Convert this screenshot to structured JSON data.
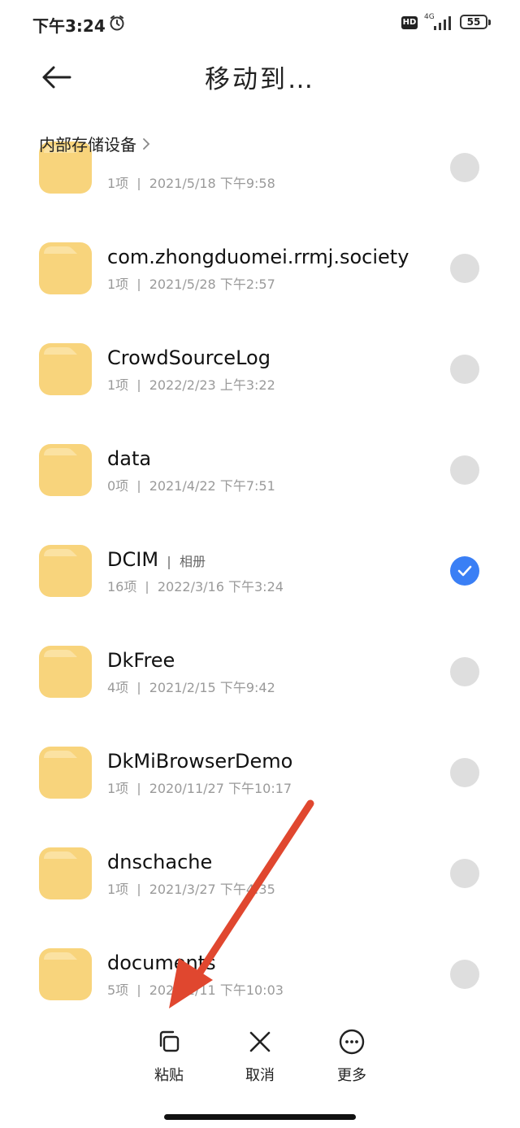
{
  "status_bar": {
    "time": "下午3:24",
    "hd_badge": "HD",
    "network": "4G",
    "battery": "55",
    "icons": [
      "alarm-icon",
      "signal-icon",
      "battery-icon"
    ]
  },
  "header": {
    "title": "移动到…",
    "back_icon": "back-arrow-icon"
  },
  "breadcrumb": {
    "label": "内部存储设备"
  },
  "folders": [
    {
      "name": "",
      "tag": "",
      "count": "1项",
      "date": "2021/5/18 下午9:58",
      "selected": false
    },
    {
      "name": "com.zhongduomei.rrmj.society",
      "tag": "",
      "count": "1项",
      "date": "2021/5/28 下午2:57",
      "selected": false
    },
    {
      "name": "CrowdSourceLog",
      "tag": "",
      "count": "1项",
      "date": "2022/2/23 上午3:22",
      "selected": false
    },
    {
      "name": "data",
      "tag": "",
      "count": "0项",
      "date": "2021/4/22 下午7:51",
      "selected": false
    },
    {
      "name": "DCIM",
      "tag": "相册",
      "count": "16项",
      "date": "2022/3/16 下午3:24",
      "selected": true
    },
    {
      "name": "DkFree",
      "tag": "",
      "count": "4项",
      "date": "2021/2/15 下午9:42",
      "selected": false
    },
    {
      "name": "DkMiBrowserDemo",
      "tag": "",
      "count": "1项",
      "date": "2020/11/27 下午10:17",
      "selected": false
    },
    {
      "name": "dnschache",
      "tag": "",
      "count": "1项",
      "date": "2021/3/27 下午4:35",
      "selected": false
    },
    {
      "name": "documents",
      "tag": "",
      "count": "5项",
      "date": "2022/1/11 下午10:03",
      "selected": false
    }
  ],
  "toolbar": {
    "paste_label": "粘贴",
    "cancel_label": "取消",
    "more_label": "更多"
  },
  "colors": {
    "folder": "#f8d47c",
    "folder_tab": "#fbe2a2",
    "checked": "#3a7ff5",
    "unchecked": "#dedede",
    "annotation_arrow": "#e0472f"
  }
}
